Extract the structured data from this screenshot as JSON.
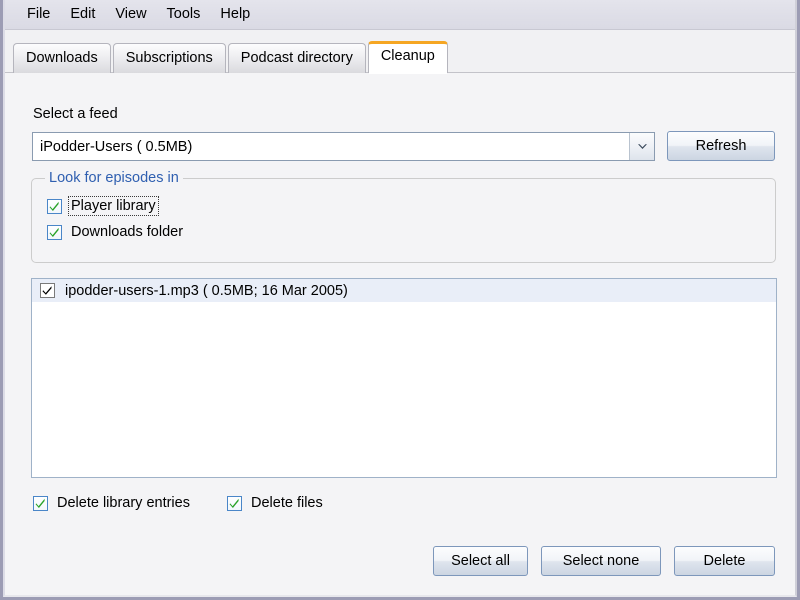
{
  "menu": {
    "items": [
      {
        "label": "File"
      },
      {
        "label": "Edit"
      },
      {
        "label": "View"
      },
      {
        "label": "Tools"
      },
      {
        "label": "Help"
      }
    ]
  },
  "tabs": [
    {
      "label": "Downloads",
      "active": false
    },
    {
      "label": "Subscriptions",
      "active": false
    },
    {
      "label": "Podcast directory",
      "active": false
    },
    {
      "label": "Cleanup",
      "active": true
    }
  ],
  "cleanup": {
    "feed_label": "Select a feed",
    "feed_value": "iPodder-Users ( 0.5MB)",
    "feed_placeholder": "Select a feed",
    "refresh_label": "Refresh",
    "group_title": "Look for episodes in",
    "sources": [
      {
        "label": "Player library",
        "checked": true,
        "focused": true
      },
      {
        "label": "Downloads folder",
        "checked": true,
        "focused": false
      }
    ],
    "episodes": [
      {
        "label": "ipodder-users-1.mp3 ( 0.5MB; 16 Mar 2005)",
        "checked": true,
        "selected": true
      }
    ],
    "delete_options": [
      {
        "label": "Delete library entries",
        "checked": true
      },
      {
        "label": "Delete files",
        "checked": true
      }
    ],
    "actions": [
      {
        "label": "Select all"
      },
      {
        "label": "Select none"
      },
      {
        "label": "Delete"
      }
    ]
  },
  "colors": {
    "active_tab_accent": "#f5a623",
    "group_title": "#2f5fb0",
    "checkbox_border": "#4a86c8",
    "checkbox_check": "#2aa32a",
    "selection_bg": "#e9eef8",
    "window_frame": "#9c9cb4",
    "page_bg": "#f4f4f6"
  },
  "icons": {
    "dropdown": "chevron-down-icon",
    "checkmark": "check-icon"
  }
}
